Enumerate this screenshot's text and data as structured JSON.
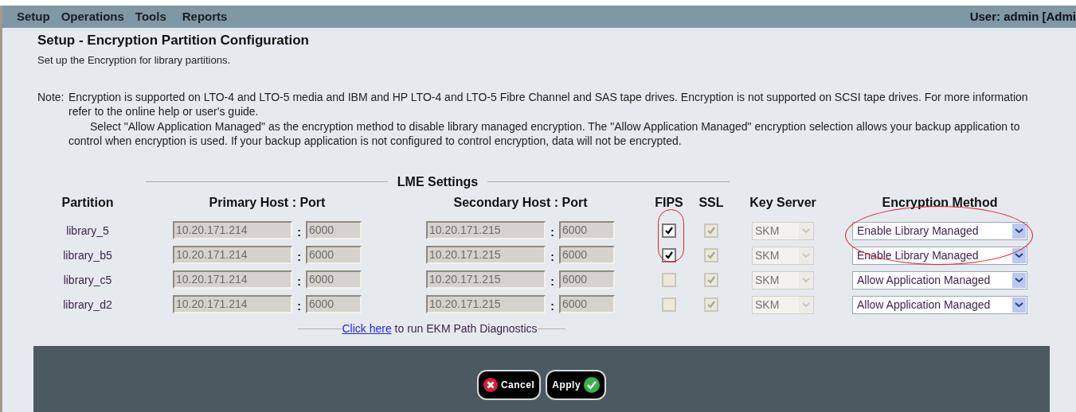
{
  "menu": [
    {
      "label": "Setup"
    },
    {
      "label": "Operations"
    },
    {
      "label": "Tools"
    },
    {
      "label": "Reports"
    }
  ],
  "user": "User: admin [Admi",
  "title": "Setup - Encryption Partition Configuration",
  "subtitle": "Set up the Encryption for library partitions.",
  "note": {
    "label": "Note:",
    "paragraphs": [
      "Encryption is supported on LTO-4 and LTO-5 media and IBM and HP LTO-4 and LTO-5 Fibre Channel and SAS tape drives. Encryption is not supported on SCSI tape drives. For more information refer to the online help or user's guide.",
      "Select \"Allow Application Managed\" as the encryption method to disable library managed encryption. The \"Allow Application Managed\" encryption selection allows your backup application to control when encryption is used. If your backup application is not configured to control encryption, data will not be encrypted."
    ]
  },
  "section_title": "LME Settings",
  "columns": [
    "Partition",
    "Primary Host : Port",
    "Secondary Host : Port",
    "FIPS",
    "SSL",
    "Key Server",
    "Encryption Method"
  ],
  "separator": ":",
  "rows": [
    {
      "partition": "library_5",
      "primary_host": "10.20.171.214",
      "primary_port": "6000",
      "secondary_host": "10.20.171.215",
      "secondary_port": "6000",
      "fips": {
        "checked": true,
        "disabled": false
      },
      "ssl": {
        "checked": true,
        "disabled": true
      },
      "key_server": "SKM",
      "method": "Enable Library Managed"
    },
    {
      "partition": "library_b5",
      "primary_host": "10.20.171.214",
      "primary_port": "6000",
      "secondary_host": "10.20.171.215",
      "secondary_port": "6000",
      "fips": {
        "checked": true,
        "disabled": false
      },
      "ssl": {
        "checked": true,
        "disabled": true
      },
      "key_server": "SKM",
      "method": "Enable Library Managed"
    },
    {
      "partition": "library_c5",
      "primary_host": "10.20.171.214",
      "primary_port": "6000",
      "secondary_host": "10.20.171.215",
      "secondary_port": "6000",
      "fips": {
        "checked": false,
        "disabled": true
      },
      "ssl": {
        "checked": true,
        "disabled": true
      },
      "key_server": "SKM",
      "method": "Allow Application Managed"
    },
    {
      "partition": "library_d2",
      "primary_host": "10.20.171.214",
      "primary_port": "6000",
      "secondary_host": "10.20.171.215",
      "secondary_port": "6000",
      "fips": {
        "checked": false,
        "disabled": true
      },
      "ssl": {
        "checked": true,
        "disabled": true
      },
      "key_server": "SKM",
      "method": "Allow Application Managed"
    }
  ],
  "diagnostics": {
    "link": "Click here",
    "text": "to run EKM Path Diagnostics"
  },
  "buttons": [
    {
      "kind": "cancel",
      "label": "Cancel"
    },
    {
      "kind": "apply",
      "label": "Apply"
    }
  ]
}
